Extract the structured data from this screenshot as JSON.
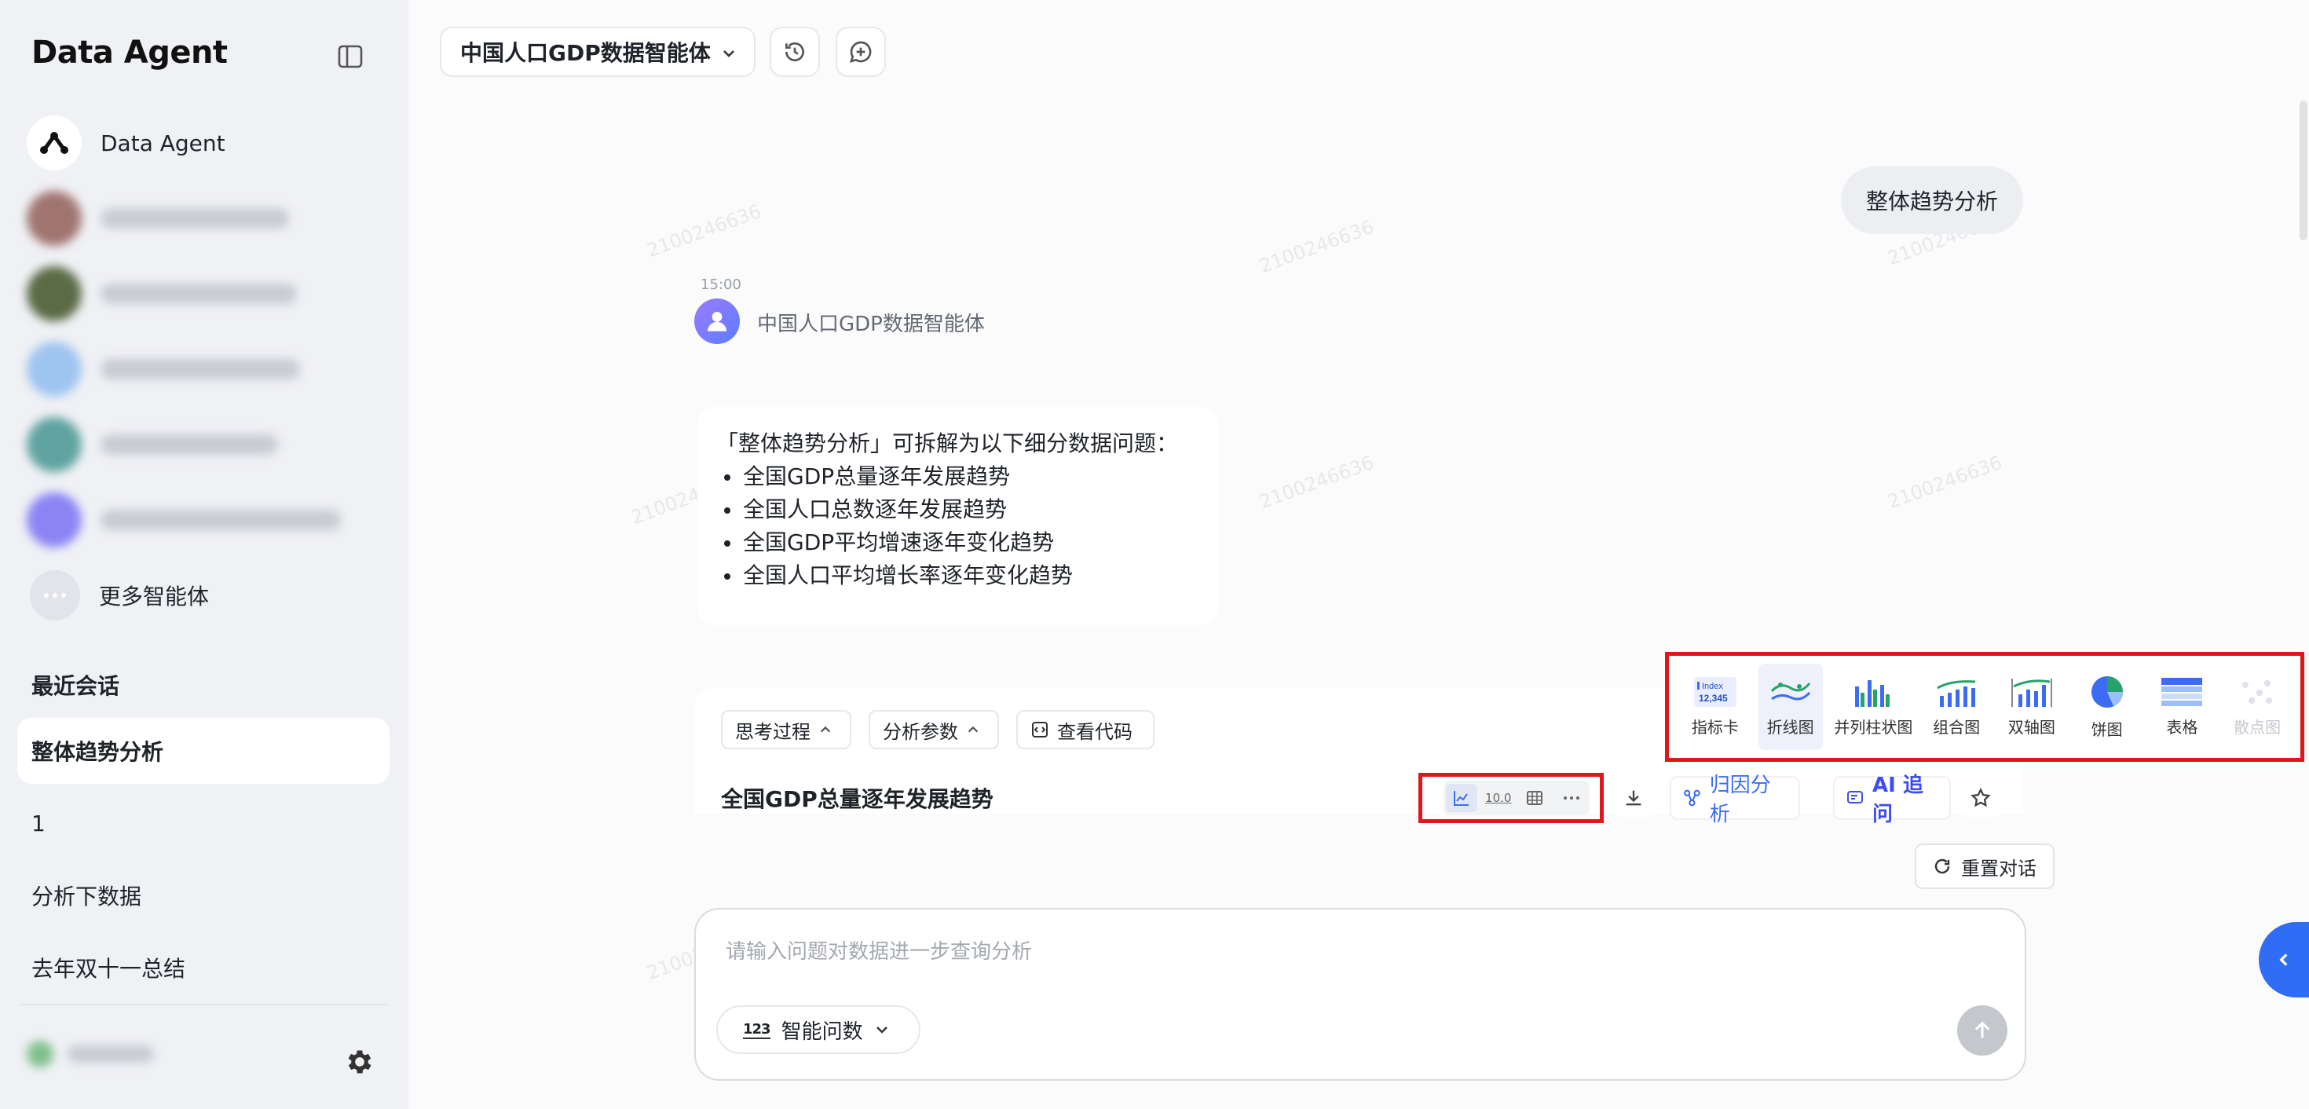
{
  "sidebar": {
    "brand": "Data Agent",
    "agents": [
      {
        "label": "Data Agent"
      }
    ],
    "more_label": "更多智能体",
    "recent_title": "最近会话",
    "conversations": [
      {
        "label": "整体趋势分析",
        "active": true
      },
      {
        "label": "1"
      },
      {
        "label": "分析下数据"
      },
      {
        "label": "去年双十一总结"
      }
    ]
  },
  "header": {
    "agent_name": "中国人口GDP数据智能体"
  },
  "chat": {
    "user_message": "整体趋势分析",
    "time": "15:00",
    "bot_name": "中国人口GDP数据智能体",
    "reply_intro": "「整体趋势分析」可拆解为以下细分数据问题：",
    "reply_items": [
      "全国GDP总量逐年发展趋势",
      "全国人口总数逐年发展趋势",
      "全国GDP平均增速逐年变化趋势",
      "全国人口平均增长率逐年变化趋势"
    ]
  },
  "result": {
    "thinking_label": "思考过程",
    "params_label": "分析参数",
    "code_label": "查看代码",
    "title": "全国GDP总量逐年发展趋势",
    "attribution_label": "归因分析",
    "ai_label": "AI 追问"
  },
  "chart_types": [
    {
      "label": "指标卡",
      "icon": "index-card-icon"
    },
    {
      "label": "折线图",
      "icon": "line-chart-icon",
      "selected": true
    },
    {
      "label": "并列柱状图",
      "icon": "grouped-bar-icon"
    },
    {
      "label": "组合图",
      "icon": "combo-chart-icon"
    },
    {
      "label": "双轴图",
      "icon": "dual-axis-icon"
    },
    {
      "label": "饼图",
      "icon": "pie-chart-icon"
    },
    {
      "label": "表格",
      "icon": "table-icon"
    },
    {
      "label": "散点图",
      "icon": "scatter-icon",
      "disabled": true
    }
  ],
  "index_card": {
    "line1": "Index",
    "line2": "12,345"
  },
  "number_format_glyph": "10.0",
  "reset_label": "重置对话",
  "composer": {
    "placeholder": "请输入问题对数据进一步查询分析",
    "mode_glyph": "123",
    "mode_label": "智能问数"
  },
  "colors": {
    "accent": "#2f6df5",
    "highlight": "#e0161b"
  }
}
